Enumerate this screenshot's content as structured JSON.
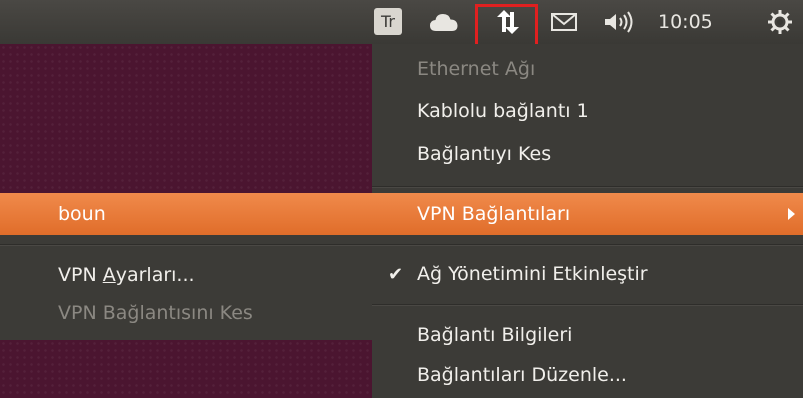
{
  "panel": {
    "keyboard_indicator": "Tr",
    "clock": "10:05",
    "icons": [
      "keyboard-layout-icon",
      "cloud-icon",
      "network-updown-icon",
      "mail-icon",
      "volume-icon",
      "power-gear-icon"
    ],
    "highlight_color": "#e02020"
  },
  "network_menu": {
    "ethernet_header": "Ethernet Ağı",
    "wired_connection": "Kablolu bağlantı 1",
    "disconnect": "Bağlantıyı Kes",
    "vpn_connections": "VPN Bağlantıları",
    "enable_networking_check": "✔",
    "enable_networking": "Ağ Yönetimini Etkinleştir",
    "connection_info": "Bağlantı Bilgileri",
    "edit_connections": "Bağlantıları Düzenle..."
  },
  "vpn_submenu": {
    "vpn_name": "boun",
    "vpn_settings_prefix": "VPN ",
    "vpn_settings_mnemonic": "A",
    "vpn_settings_rest": "yarları...",
    "vpn_disconnect": "VPN Bağlantısını Kes"
  },
  "colors": {
    "accent": "#f0844a",
    "menu_bg": "#3c3b37",
    "desktop_bg": "#4b1530"
  }
}
